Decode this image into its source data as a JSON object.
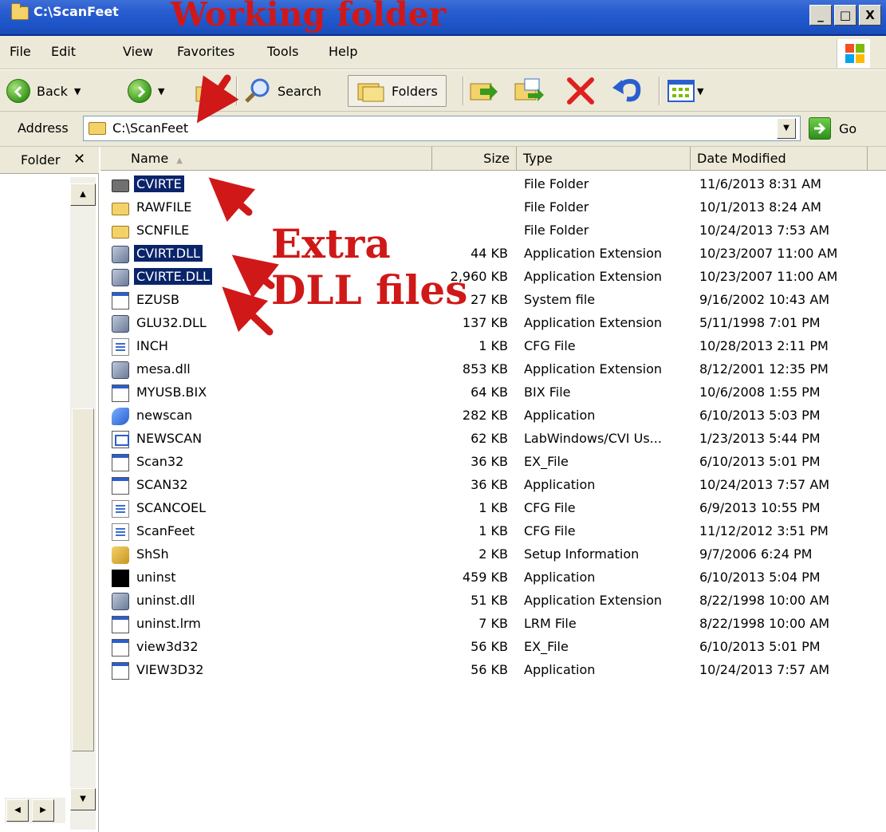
{
  "window": {
    "title": "C:\\ScanFeet",
    "buttons": [
      "_",
      "□",
      "X"
    ]
  },
  "menu": [
    "File",
    "Edit",
    "View",
    "Favorites",
    "Tools",
    "Help"
  ],
  "toolbar": {
    "back_label": "Back",
    "search_label": "Search",
    "folders_label": "Folders"
  },
  "address": {
    "label": "Address",
    "value": "C:\\ScanFeet",
    "go_label": "Go"
  },
  "left_pane": {
    "title": "Folder",
    "close": "✕"
  },
  "columns": [
    "Name",
    "Size",
    "Type",
    "Date Modified"
  ],
  "files": [
    {
      "name": "CVIRTE",
      "size": "",
      "type": "File Folder",
      "date": "11/6/2013 8:31 AM",
      "icon": "folder-dark-icon",
      "selected": true
    },
    {
      "name": "RAWFILE",
      "size": "",
      "type": "File Folder",
      "date": "10/1/2013 8:24 AM",
      "icon": "folder-icon",
      "selected": false
    },
    {
      "name": "SCNFILE",
      "size": "",
      "type": "File Folder",
      "date": "10/24/2013 7:53 AM",
      "icon": "folder-icon",
      "selected": false
    },
    {
      "name": "CVIRT.DLL",
      "size": "44 KB",
      "type": "Application Extension",
      "date": "10/23/2007 11:00 AM",
      "icon": "dll-icon",
      "selected": true
    },
    {
      "name": "CVIRTE.DLL",
      "size": "2,960 KB",
      "type": "Application Extension",
      "date": "10/23/2007 11:00 AM",
      "icon": "dll-icon",
      "selected": true
    },
    {
      "name": "EZUSB",
      "size": "27 KB",
      "type": "System file",
      "date": "9/16/2002 10:43 AM",
      "icon": "window-file-icon",
      "selected": false
    },
    {
      "name": "GLU32.DLL",
      "size": "137 KB",
      "type": "Application Extension",
      "date": "5/11/1998 7:01 PM",
      "icon": "dll-icon",
      "selected": false
    },
    {
      "name": "INCH",
      "size": "1 KB",
      "type": "CFG File",
      "date": "10/28/2013 2:11 PM",
      "icon": "text-file-icon",
      "selected": false
    },
    {
      "name": "mesa.dll",
      "size": "853 KB",
      "type": "Application Extension",
      "date": "8/12/2001 12:35 PM",
      "icon": "dll-icon",
      "selected": false
    },
    {
      "name": "MYUSB.BIX",
      "size": "64 KB",
      "type": "BIX File",
      "date": "10/6/2008 1:55 PM",
      "icon": "window-file-icon",
      "selected": false
    },
    {
      "name": "newscan",
      "size": "282 KB",
      "type": "Application",
      "date": "6/10/2013 5:03 PM",
      "icon": "app-icon",
      "selected": false
    },
    {
      "name": "NEWSCAN",
      "size": "62 KB",
      "type": "LabWindows/CVI Us...",
      "date": "1/23/2013 5:44 PM",
      "icon": "cvi-file-icon",
      "selected": false
    },
    {
      "name": "Scan32",
      "size": "36 KB",
      "type": "EX_File",
      "date": "6/10/2013 5:01 PM",
      "icon": "window-file-icon",
      "selected": false
    },
    {
      "name": "SCAN32",
      "size": "36 KB",
      "type": "Application",
      "date": "10/24/2013 7:57 AM",
      "icon": "window-app-icon",
      "selected": false
    },
    {
      "name": "SCANCOEL",
      "size": "1 KB",
      "type": "CFG File",
      "date": "6/9/2013 10:55 PM",
      "icon": "text-file-icon",
      "selected": false
    },
    {
      "name": "ScanFeet",
      "size": "1 KB",
      "type": "CFG File",
      "date": "11/12/2012 3:51 PM",
      "icon": "text-file-icon",
      "selected": false
    },
    {
      "name": "ShSh",
      "size": "2 KB",
      "type": "Setup Information",
      "date": "9/7/2006 6:24 PM",
      "icon": "setup-icon",
      "selected": false
    },
    {
      "name": "uninst",
      "size": "459 KB",
      "type": "Application",
      "date": "6/10/2013 5:04 PM",
      "icon": "uninstall-icon",
      "selected": false
    },
    {
      "name": "uninst.dll",
      "size": "51 KB",
      "type": "Application Extension",
      "date": "8/22/1998 10:00 AM",
      "icon": "dll-icon",
      "selected": false
    },
    {
      "name": "uninst.lrm",
      "size": "7 KB",
      "type": "LRM File",
      "date": "8/22/1998 10:00 AM",
      "icon": "window-file-icon",
      "selected": false
    },
    {
      "name": "view3d32",
      "size": "56 KB",
      "type": "EX_File",
      "date": "6/10/2013 5:01 PM",
      "icon": "window-file-icon",
      "selected": false
    },
    {
      "name": "VIEW3D32",
      "size": "56 KB",
      "type": "Application",
      "date": "10/24/2013 7:57 AM",
      "icon": "window-app-icon",
      "selected": false
    }
  ],
  "annotations": {
    "working_folder": "Working folder",
    "extra_line1": "Extra",
    "extra_line2": "DLL files"
  },
  "colors": {
    "annotation": "#d01818",
    "selection": "#0a246a",
    "titlebar": "#2a5ed0"
  }
}
